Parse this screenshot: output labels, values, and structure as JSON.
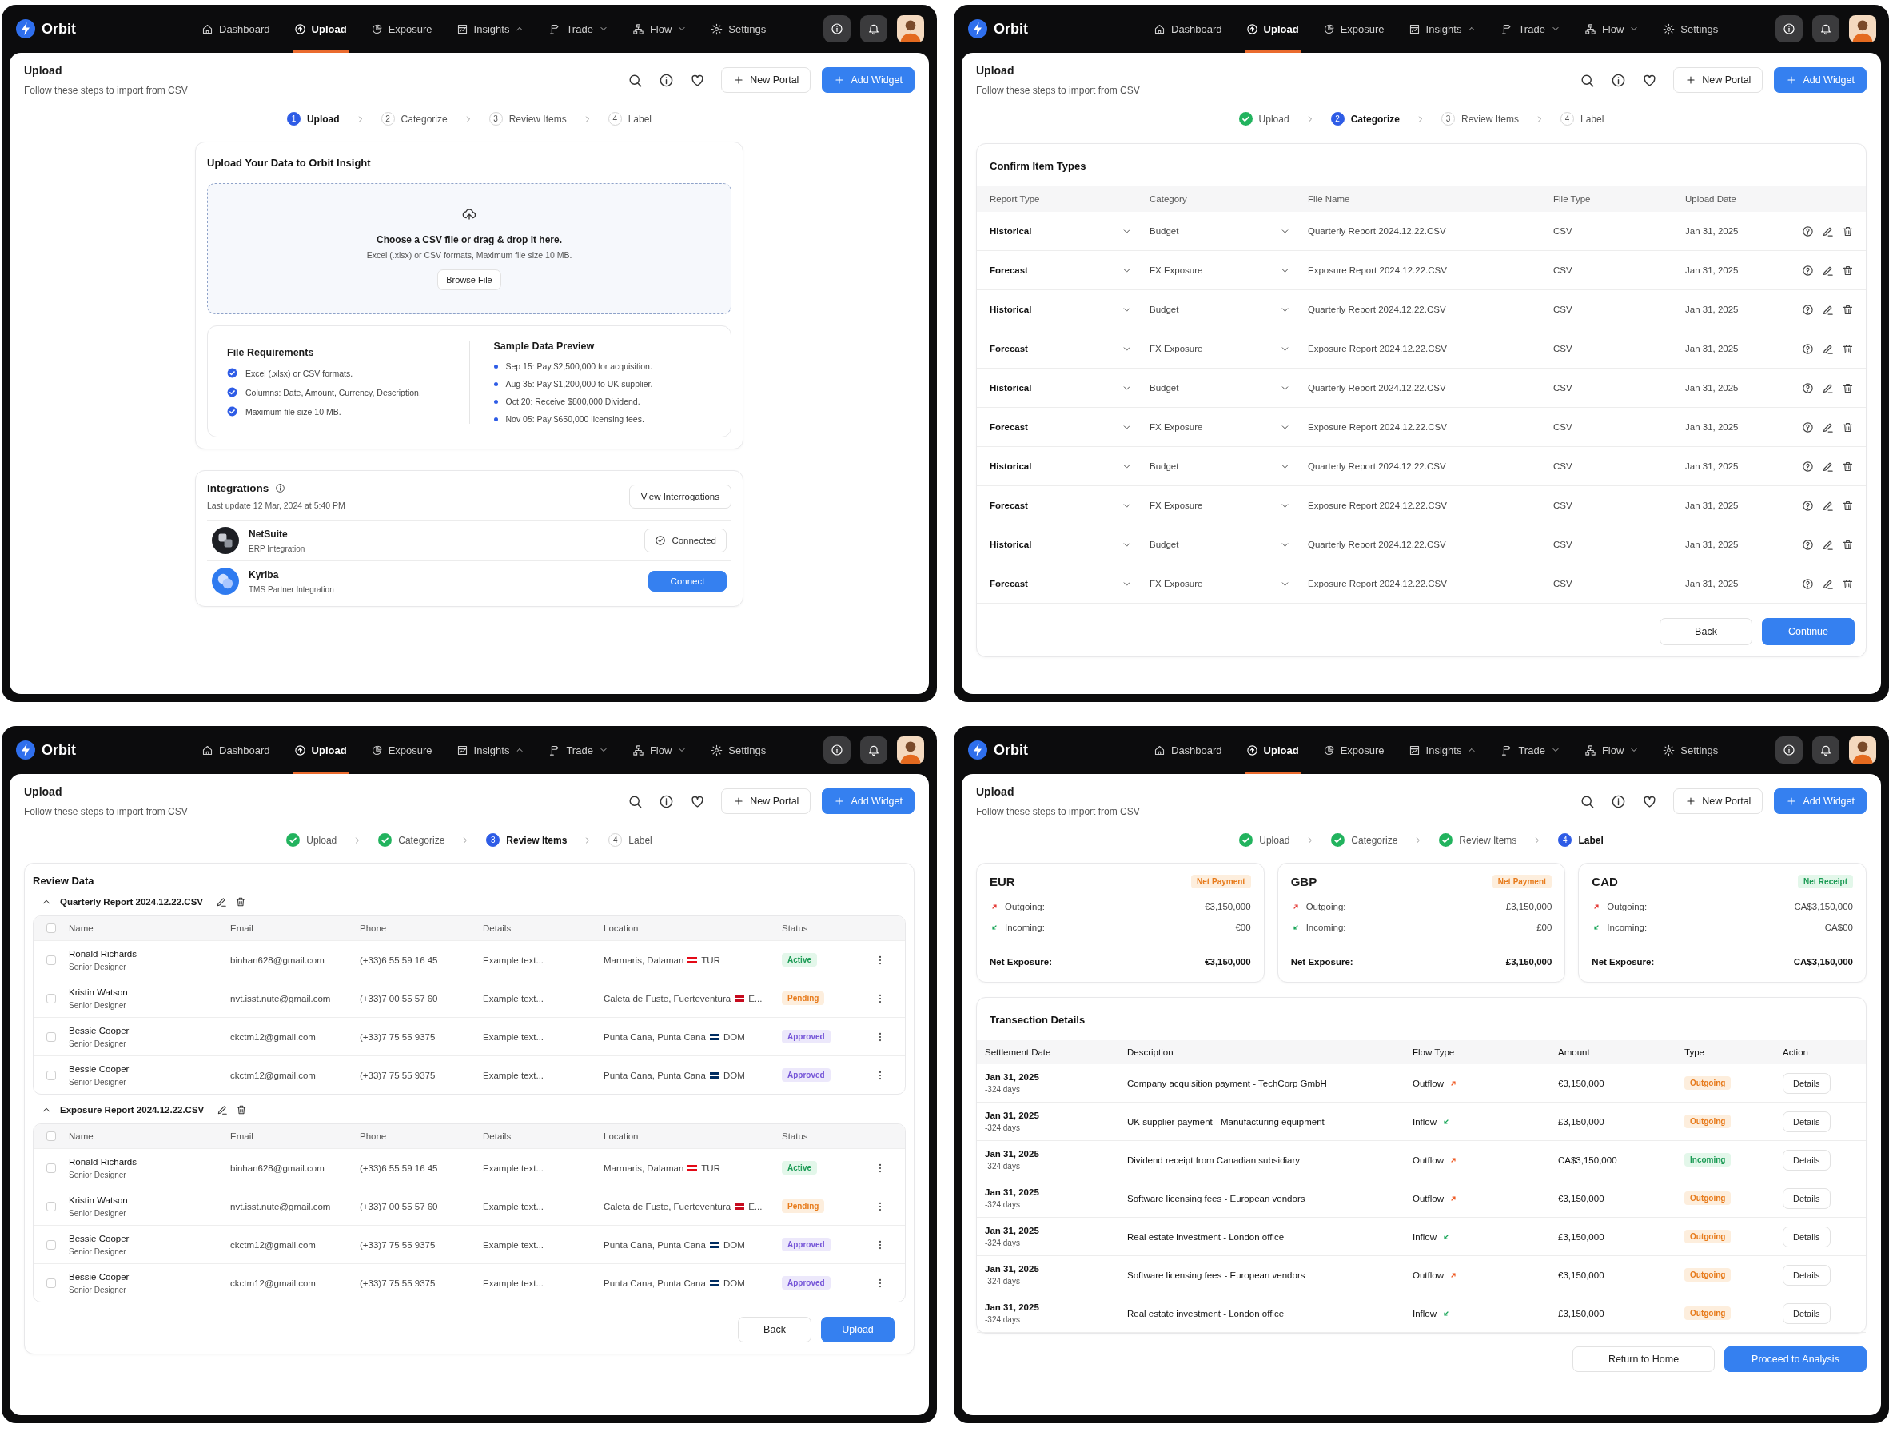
{
  "panels": [
    {
      "nav": {
        "brand": "Orbit",
        "items": [
          {
            "label": "Dashboard",
            "selected": false,
            "has_menu": false
          },
          {
            "label": "Upload",
            "selected": true,
            "has_menu": false
          },
          {
            "label": "Exposure",
            "selected": false,
            "has_menu": false
          },
          {
            "label": "Insights",
            "selected": false,
            "has_menu": true,
            "menu_open": true
          },
          {
            "label": "Trade",
            "selected": false,
            "has_menu": true,
            "menu_open": false
          },
          {
            "label": "Flow",
            "selected": false,
            "has_menu": true,
            "menu_open": false
          },
          {
            "label": "Settings",
            "selected": false,
            "has_menu": false
          }
        ]
      },
      "header": {
        "title": "Upload",
        "subtitle": "Follow these steps to import from CSV",
        "buttons": [
          {
            "label": "New Portal",
            "kind": "secondary"
          },
          {
            "label": "Add Widget",
            "kind": "primary"
          }
        ]
      },
      "steps": [
        {
          "number": "1",
          "label": "Upload",
          "done": false,
          "selected": true
        },
        {
          "number": "2",
          "label": "Categorize",
          "done": false,
          "selected": false
        },
        {
          "number": "3",
          "label": "Review Items",
          "done": false,
          "selected": false
        },
        {
          "number": "4",
          "label": "Label",
          "done": false,
          "selected": false
        }
      ],
      "body": {
        "kind": "upload",
        "upload": {
          "title": "Upload Your Data to Orbit Insight",
          "drop_title": "Choose a CSV file or drag & drop it here.",
          "drop_hint": "Excel (.xlsx) or CSV formats, Maximum file size 10 MB.",
          "button": "Browse File",
          "requirements": {
            "title": "File Requirements",
            "items": [
              "Excel (.xlsx) or CSV formats.",
              "Columns: Date, Amount, Currency, Description.",
              "Maximum file size 10 MB."
            ]
          },
          "preview": {
            "title": "Sample Data Preview",
            "items": [
              "Sep 15: Pay $2,500,000 for acquisition.",
              "Aug 35: Pay $1,200,000 to UK supplier.",
              "Oct 20: Receive $800,000 Dividend.",
              "Nov 05: Pay $650,000 licensing fees."
            ]
          }
        },
        "integrations": {
          "title": "Integrations",
          "updated": "Last update 12 Mar, 2024 at 5:40 PM",
          "button": "View Interrogations",
          "items": [
            {
              "name": "NetSuite",
              "type": "ERP Integration",
              "connected": true,
              "action": "Connected"
            },
            {
              "name": "Kyriba",
              "type": "TMS Partner Integration",
              "connected": false,
              "action": "Connect"
            }
          ]
        }
      }
    },
    {
      "nav": {
        "brand": "Orbit",
        "items": [
          {
            "label": "Dashboard",
            "selected": false,
            "has_menu": false
          },
          {
            "label": "Upload",
            "selected": true,
            "has_menu": false
          },
          {
            "label": "Exposure",
            "selected": false,
            "has_menu": false
          },
          {
            "label": "Insights",
            "selected": false,
            "has_menu": true,
            "menu_open": true
          },
          {
            "label": "Trade",
            "selected": false,
            "has_menu": true,
            "menu_open": false
          },
          {
            "label": "Flow",
            "selected": false,
            "has_menu": true,
            "menu_open": false
          },
          {
            "label": "Settings",
            "selected": false,
            "has_menu": false
          }
        ]
      },
      "header": {
        "title": "Upload",
        "subtitle": "Follow these steps to import from CSV",
        "buttons": [
          {
            "label": "New Portal",
            "kind": "secondary"
          },
          {
            "label": "Add Widget",
            "kind": "primary"
          }
        ]
      },
      "steps": [
        {
          "label": "Upload",
          "done": true,
          "selected": false
        },
        {
          "number": "2",
          "label": "Categorize",
          "done": false,
          "selected": true
        },
        {
          "number": "3",
          "label": "Review Items",
          "done": false,
          "selected": false
        },
        {
          "number": "4",
          "label": "Label",
          "done": false,
          "selected": false
        }
      ],
      "body": {
        "kind": "categorize",
        "title": "Confirm Item Types",
        "columns": [
          "Report Type",
          "Category",
          "File Name",
          "File Type",
          "Upload Date"
        ],
        "rows": [
          {
            "report_type": "Historical",
            "category": "Budget",
            "file_name": "Quarterly Report 2024.12.22.CSV",
            "file_type": "CSV",
            "date": "Jan 31, 2025"
          },
          {
            "report_type": "Forecast",
            "category": "FX Exposure",
            "file_name": "Exposure Report 2024.12.22.CSV",
            "file_type": "CSV",
            "date": "Jan 31, 2025"
          },
          {
            "report_type": "Historical",
            "category": "Budget",
            "file_name": "Quarterly Report 2024.12.22.CSV",
            "file_type": "CSV",
            "date": "Jan 31, 2025"
          },
          {
            "report_type": "Forecast",
            "category": "FX Exposure",
            "file_name": "Exposure Report 2024.12.22.CSV",
            "file_type": "CSV",
            "date": "Jan 31, 2025"
          },
          {
            "report_type": "Historical",
            "category": "Budget",
            "file_name": "Quarterly Report 2024.12.22.CSV",
            "file_type": "CSV",
            "date": "Jan 31, 2025"
          },
          {
            "report_type": "Forecast",
            "category": "FX Exposure",
            "file_name": "Exposure Report 2024.12.22.CSV",
            "file_type": "CSV",
            "date": "Jan 31, 2025"
          },
          {
            "report_type": "Historical",
            "category": "Budget",
            "file_name": "Quarterly Report 2024.12.22.CSV",
            "file_type": "CSV",
            "date": "Jan 31, 2025"
          },
          {
            "report_type": "Forecast",
            "category": "FX Exposure",
            "file_name": "Exposure Report 2024.12.22.CSV",
            "file_type": "CSV",
            "date": "Jan 31, 2025"
          },
          {
            "report_type": "Historical",
            "category": "Budget",
            "file_name": "Quarterly Report 2024.12.22.CSV",
            "file_type": "CSV",
            "date": "Jan 31, 2025"
          },
          {
            "report_type": "Forecast",
            "category": "FX Exposure",
            "file_name": "Exposure Report 2024.12.22.CSV",
            "file_type": "CSV",
            "date": "Jan 31, 2025"
          }
        ],
        "buttons": [
          {
            "label": "Back",
            "kind": "secondary"
          },
          {
            "label": "Continue",
            "kind": "primary"
          }
        ]
      }
    },
    {
      "nav": {
        "brand": "Orbit",
        "items": [
          {
            "label": "Dashboard",
            "selected": false,
            "has_menu": false
          },
          {
            "label": "Upload",
            "selected": true,
            "has_menu": false
          },
          {
            "label": "Exposure",
            "selected": false,
            "has_menu": false
          },
          {
            "label": "Insights",
            "selected": false,
            "has_menu": true,
            "menu_open": true
          },
          {
            "label": "Trade",
            "selected": false,
            "has_menu": true,
            "menu_open": false
          },
          {
            "label": "Flow",
            "selected": false,
            "has_menu": true,
            "menu_open": false
          },
          {
            "label": "Settings",
            "selected": false,
            "has_menu": false
          }
        ]
      },
      "header": {
        "title": "Upload",
        "subtitle": "Follow these steps to import from CSV",
        "buttons": [
          {
            "label": "New Portal",
            "kind": "secondary"
          },
          {
            "label": "Add Widget",
            "kind": "primary"
          }
        ]
      },
      "steps": [
        {
          "label": "Upload",
          "done": true,
          "selected": false
        },
        {
          "label": "Categorize",
          "done": true,
          "selected": false
        },
        {
          "number": "3",
          "label": "Review Items",
          "done": false,
          "selected": true
        },
        {
          "number": "4",
          "label": "Label",
          "done": false,
          "selected": false
        }
      ],
      "body": {
        "kind": "review",
        "title": "Review Data",
        "groups": [
          {
            "name": "Quarterly Report 2024.12.22.CSV",
            "expanded": true,
            "all_checked": false,
            "columns": [
              "Name",
              "Email",
              "Phone",
              "Details",
              "Location",
              "Status"
            ],
            "rows": [
              {
                "checked": false,
                "name": "Ronald Richards",
                "role": "Senior Designer",
                "email": "binhan628@gmail.com",
                "phone": "(+33)6 55 59 16 45",
                "details": "Example text...",
                "location": {
                  "place": "Marmaris, Dalaman",
                  "code": "TUR",
                  "color": "#e30a17"
                },
                "status": {
                  "label": "Active",
                  "kind": "active"
                }
              },
              {
                "checked": false,
                "name": "Kristin Watson",
                "role": "Senior Designer",
                "email": "nvt.isst.nute@gmail.com",
                "phone": "(+33)7 00 55 57 60",
                "details": "Example text...",
                "location": {
                  "place": "Caleta de Fuste, Fuerteventura",
                  "code": "E...",
                  "color": "#c60b1e"
                },
                "status": {
                  "label": "Pending",
                  "kind": "pending"
                }
              },
              {
                "checked": false,
                "name": "Bessie Cooper",
                "role": "Senior Designer",
                "email": "ckctm12@gmail.com",
                "phone": "(+33)7 75 55 9375",
                "details": "Example text...",
                "location": {
                  "place": "Punta Cana, Punta Cana",
                  "code": "DOM",
                  "color": "#002d62"
                },
                "status": {
                  "label": "Approved",
                  "kind": "approved"
                }
              },
              {
                "checked": false,
                "name": "Bessie Cooper",
                "role": "Senior Designer",
                "email": "ckctm12@gmail.com",
                "phone": "(+33)7 75 55 9375",
                "details": "Example text...",
                "location": {
                  "place": "Punta Cana, Punta Cana",
                  "code": "DOM",
                  "color": "#002d62"
                },
                "status": {
                  "label": "Approved",
                  "kind": "approved"
                }
              }
            ]
          },
          {
            "name": "Exposure Report 2024.12.22.CSV",
            "expanded": true,
            "all_checked": false,
            "columns": [
              "Name",
              "Email",
              "Phone",
              "Details",
              "Location",
              "Status"
            ],
            "rows": [
              {
                "checked": false,
                "name": "Ronald Richards",
                "role": "Senior Designer",
                "email": "binhan628@gmail.com",
                "phone": "(+33)6 55 59 16 45",
                "details": "Example text...",
                "location": {
                  "place": "Marmaris, Dalaman",
                  "code": "TUR",
                  "color": "#e30a17"
                },
                "status": {
                  "label": "Active",
                  "kind": "active"
                }
              },
              {
                "checked": false,
                "name": "Kristin Watson",
                "role": "Senior Designer",
                "email": "nvt.isst.nute@gmail.com",
                "phone": "(+33)7 00 55 57 60",
                "details": "Example text...",
                "location": {
                  "place": "Caleta de Fuste, Fuerteventura",
                  "code": "E...",
                  "color": "#c60b1e"
                },
                "status": {
                  "label": "Pending",
                  "kind": "pending"
                }
              },
              {
                "checked": false,
                "name": "Bessie Cooper",
                "role": "Senior Designer",
                "email": "ckctm12@gmail.com",
                "phone": "(+33)7 75 55 9375",
                "details": "Example text...",
                "location": {
                  "place": "Punta Cana, Punta Cana",
                  "code": "DOM",
                  "color": "#002d62"
                },
                "status": {
                  "label": "Approved",
                  "kind": "approved"
                }
              },
              {
                "checked": false,
                "name": "Bessie Cooper",
                "role": "Senior Designer",
                "email": "ckctm12@gmail.com",
                "phone": "(+33)7 75 55 9375",
                "details": "Example text...",
                "location": {
                  "place": "Punta Cana, Punta Cana",
                  "code": "DOM",
                  "color": "#002d62"
                },
                "status": {
                  "label": "Approved",
                  "kind": "approved"
                }
              }
            ]
          }
        ],
        "buttons": [
          {
            "label": "Back",
            "kind": "secondary"
          },
          {
            "label": "Upload",
            "kind": "primary"
          }
        ]
      }
    },
    {
      "nav": {
        "brand": "Orbit",
        "items": [
          {
            "label": "Dashboard",
            "selected": false,
            "has_menu": false
          },
          {
            "label": "Upload",
            "selected": true,
            "has_menu": false
          },
          {
            "label": "Exposure",
            "selected": false,
            "has_menu": false
          },
          {
            "label": "Insights",
            "selected": false,
            "has_menu": true,
            "menu_open": true
          },
          {
            "label": "Trade",
            "selected": false,
            "has_menu": true,
            "menu_open": false
          },
          {
            "label": "Flow",
            "selected": false,
            "has_menu": true,
            "menu_open": false
          },
          {
            "label": "Settings",
            "selected": false,
            "has_menu": false
          }
        ]
      },
      "header": {
        "title": "Upload",
        "subtitle": "Follow these steps to import from CSV",
        "buttons": [
          {
            "label": "New Portal",
            "kind": "secondary"
          },
          {
            "label": "Add Widget",
            "kind": "primary"
          }
        ]
      },
      "steps": [
        {
          "label": "Upload",
          "done": true,
          "selected": false
        },
        {
          "label": "Categorize",
          "done": true,
          "selected": false
        },
        {
          "label": "Review Items",
          "done": true,
          "selected": false
        },
        {
          "number": "4",
          "label": "Label",
          "done": false,
          "selected": true
        }
      ],
      "body": {
        "kind": "label",
        "cards": [
          {
            "currency": "EUR",
            "badge": {
              "label": "Net Payment",
              "kind": "payment"
            },
            "outgoing_label": "Outgoing:",
            "outgoing": "€3,150,000",
            "incoming_label": "Incoming:",
            "incoming": "€00",
            "net_label": "Net Exposure:",
            "net": "€3,150,000"
          },
          {
            "currency": "GBP",
            "badge": {
              "label": "Net Payment",
              "kind": "payment"
            },
            "outgoing_label": "Outgoing:",
            "outgoing": "£3,150,000",
            "incoming_label": "Incoming:",
            "incoming": "£00",
            "net_label": "Net Exposure:",
            "net": "£3,150,000"
          },
          {
            "currency": "CAD",
            "badge": {
              "label": "Net Receipt",
              "kind": "receipt"
            },
            "outgoing_label": "Outgoing:",
            "outgoing": "CA$3,150,000",
            "incoming_label": "Incoming:",
            "incoming": "CA$00",
            "net_label": "Net Exposure:",
            "net": "CA$3,150,000"
          }
        ],
        "transactions": {
          "title": "Transection Details",
          "columns": [
            "Settlement Date",
            "Description",
            "Flow Type",
            "Amount",
            "Type",
            "Action"
          ],
          "rows": [
            {
              "date": "Jan 31, 2025",
              "days": "-324 days",
              "description": "Company acquisition payment - TechCorp GmbH",
              "flow": {
                "label": "Outflow",
                "kind": "out"
              },
              "amount": "€3,150,000",
              "type": {
                "label": "Outgoing",
                "kind": "outgoing"
              },
              "action": "Details"
            },
            {
              "date": "Jan 31, 2025",
              "days": "-324 days",
              "description": "UK supplier payment - Manufacturing equipment",
              "flow": {
                "label": "Inflow",
                "kind": "in"
              },
              "amount": "£3,150,000",
              "type": {
                "label": "Outgoing",
                "kind": "outgoing"
              },
              "action": "Details"
            },
            {
              "date": "Jan 31, 2025",
              "days": "-324 days",
              "description": "Dividend receipt from Canadian subsidiary",
              "flow": {
                "label": "Outflow",
                "kind": "out"
              },
              "amount": "CA$3,150,000",
              "type": {
                "label": "Incoming",
                "kind": "incoming"
              },
              "action": "Details"
            },
            {
              "date": "Jan 31, 2025",
              "days": "-324 days",
              "description": "Software licensing fees - European vendors",
              "flow": {
                "label": "Outflow",
                "kind": "out"
              },
              "amount": "€3,150,000",
              "type": {
                "label": "Outgoing",
                "kind": "outgoing"
              },
              "action": "Details"
            },
            {
              "date": "Jan 31, 2025",
              "days": "-324 days",
              "description": "Real estate investment - London office",
              "flow": {
                "label": "Inflow",
                "kind": "in"
              },
              "amount": "£3,150,000",
              "type": {
                "label": "Outgoing",
                "kind": "outgoing"
              },
              "action": "Details"
            },
            {
              "date": "Jan 31, 2025",
              "days": "-324 days",
              "description": "Software licensing fees - European vendors",
              "flow": {
                "label": "Outflow",
                "kind": "out"
              },
              "amount": "€3,150,000",
              "type": {
                "label": "Outgoing",
                "kind": "outgoing"
              },
              "action": "Details"
            },
            {
              "date": "Jan 31, 2025",
              "days": "-324 days",
              "description": "Real estate investment - London office",
              "flow": {
                "label": "Inflow",
                "kind": "in"
              },
              "amount": "£3,150,000",
              "type": {
                "label": "Outgoing",
                "kind": "outgoing"
              },
              "action": "Details"
            }
          ]
        },
        "buttons": [
          {
            "label": "Return to Home",
            "kind": "secondary"
          },
          {
            "label": "Proceed to Analysis",
            "kind": "primary"
          }
        ]
      }
    }
  ]
}
